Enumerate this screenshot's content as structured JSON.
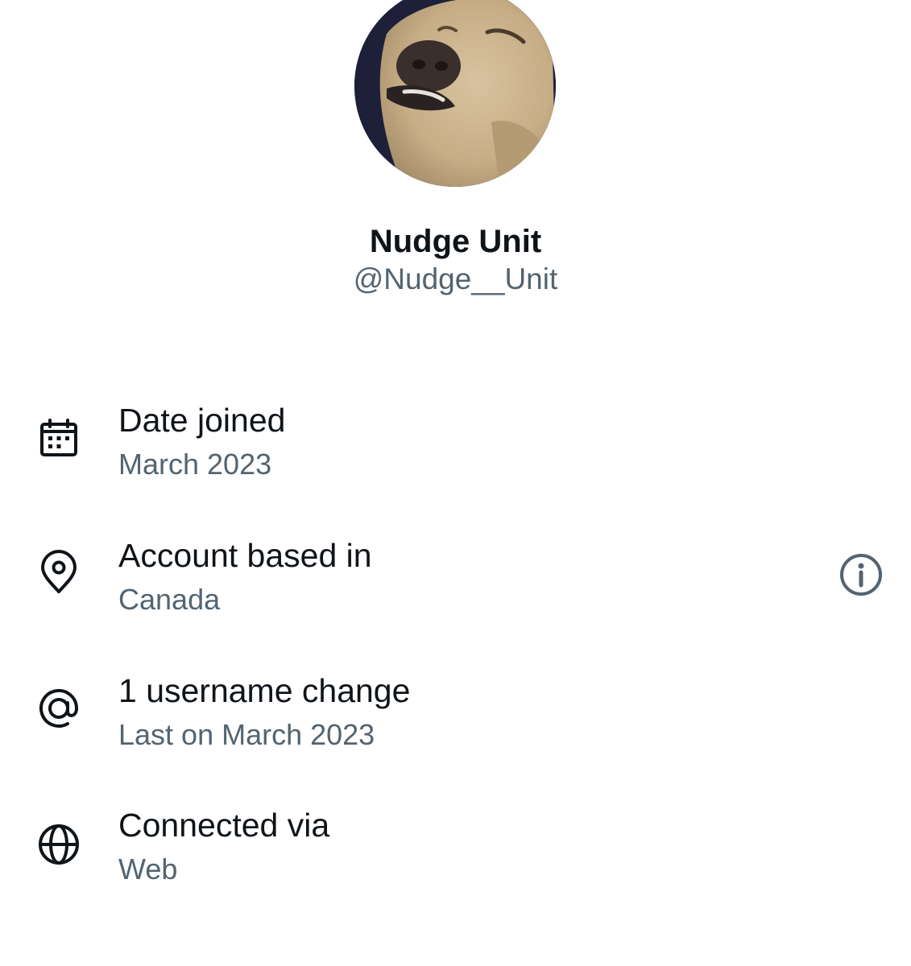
{
  "profile": {
    "display_name": "Nudge Unit",
    "handle": "@Nudge__Unit",
    "avatar_icon": "dog-photo-avatar"
  },
  "about": {
    "items": [
      {
        "icon": "calendar-icon",
        "title": "Date joined",
        "value": "March 2023"
      },
      {
        "icon": "location-pin-icon",
        "title": "Account based in",
        "value": "Canada",
        "action_icon": "info-icon"
      },
      {
        "icon": "at-sign-icon",
        "title": "1 username change",
        "value": "Last on March 2023"
      },
      {
        "icon": "globe-icon",
        "title": "Connected via",
        "value": "Web"
      }
    ]
  },
  "colors": {
    "primary_text": "#0f1419",
    "secondary_text": "#536471",
    "background": "#ffffff"
  }
}
